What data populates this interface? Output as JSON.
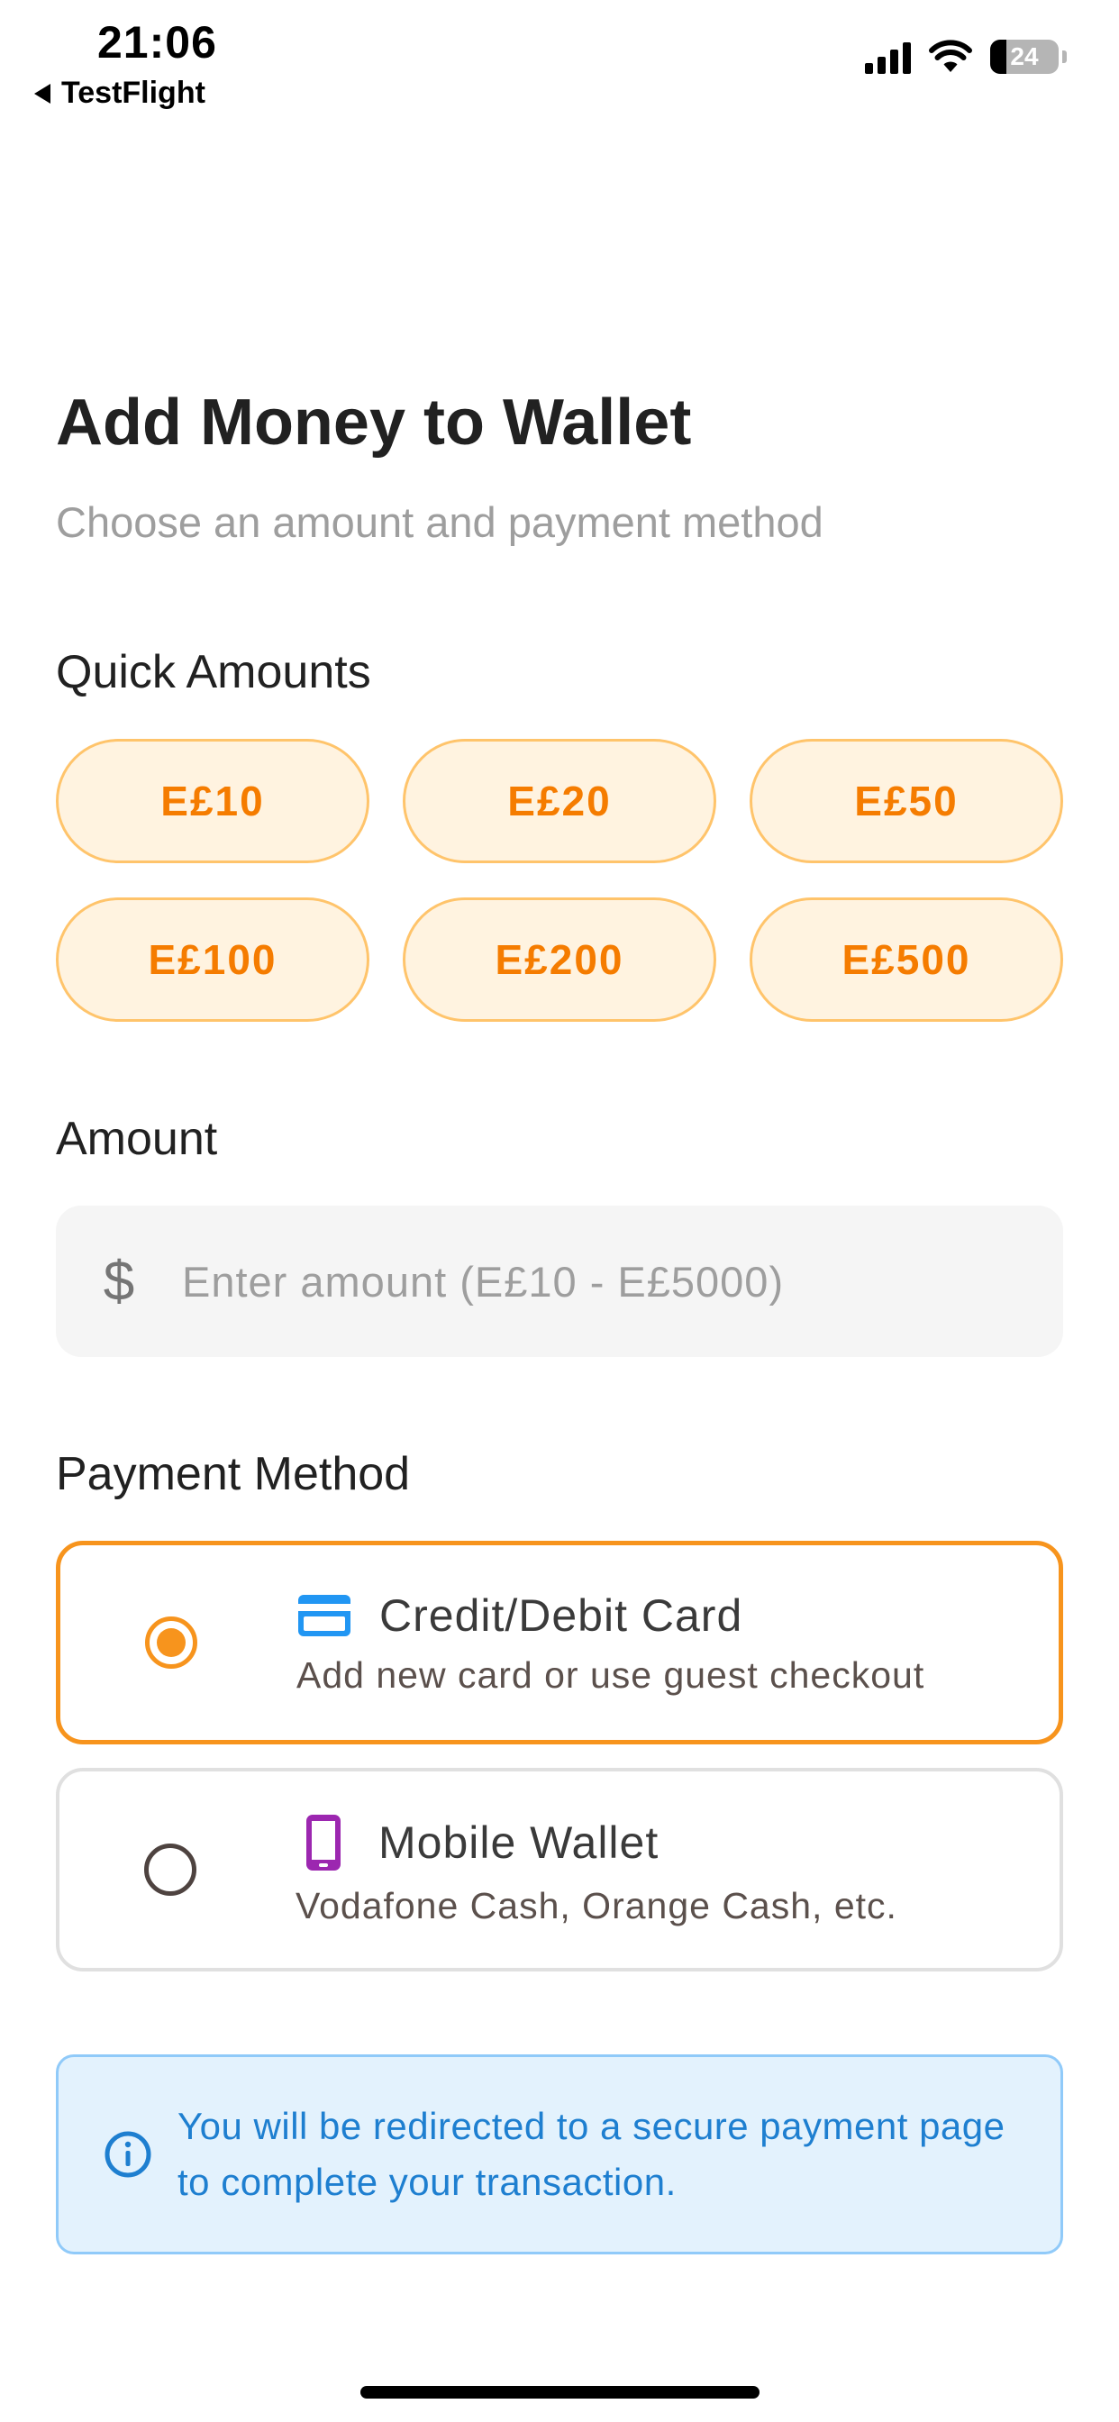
{
  "status_bar": {
    "time": "21:06",
    "back_app": "TestFlight",
    "battery": "24"
  },
  "header": {
    "title": "Add Money to Wallet",
    "subtitle": "Choose an amount and payment method"
  },
  "quick_amounts": {
    "label": "Quick Amounts",
    "items": [
      "E£10",
      "E£20",
      "E£50",
      "E£100",
      "E£200",
      "E£500"
    ]
  },
  "amount": {
    "label": "Amount",
    "prefix_symbol": "$",
    "placeholder": "Enter amount (E£10 - E£5000)",
    "value": ""
  },
  "payment_method": {
    "label": "Payment Method",
    "options": [
      {
        "title": "Credit/Debit Card",
        "description": "Add new card or use guest checkout",
        "icon": "credit-card-icon",
        "selected": true
      },
      {
        "title": "Mobile Wallet",
        "description": "Vodafone Cash, Orange Cash, etc.",
        "icon": "mobile-phone-icon",
        "selected": false
      }
    ]
  },
  "info": {
    "icon": "info-icon",
    "text": "You will be redirected to a secure payment page to complete your transaction."
  },
  "colors": {
    "accent": "#f7941d",
    "chip_background": "#fff3e0",
    "chip_text": "#f57c00",
    "card_icon": "#2196f3",
    "wallet_icon": "#9c27b0",
    "info_background": "#e3f2fd",
    "info_text": "#1e7fd0"
  }
}
